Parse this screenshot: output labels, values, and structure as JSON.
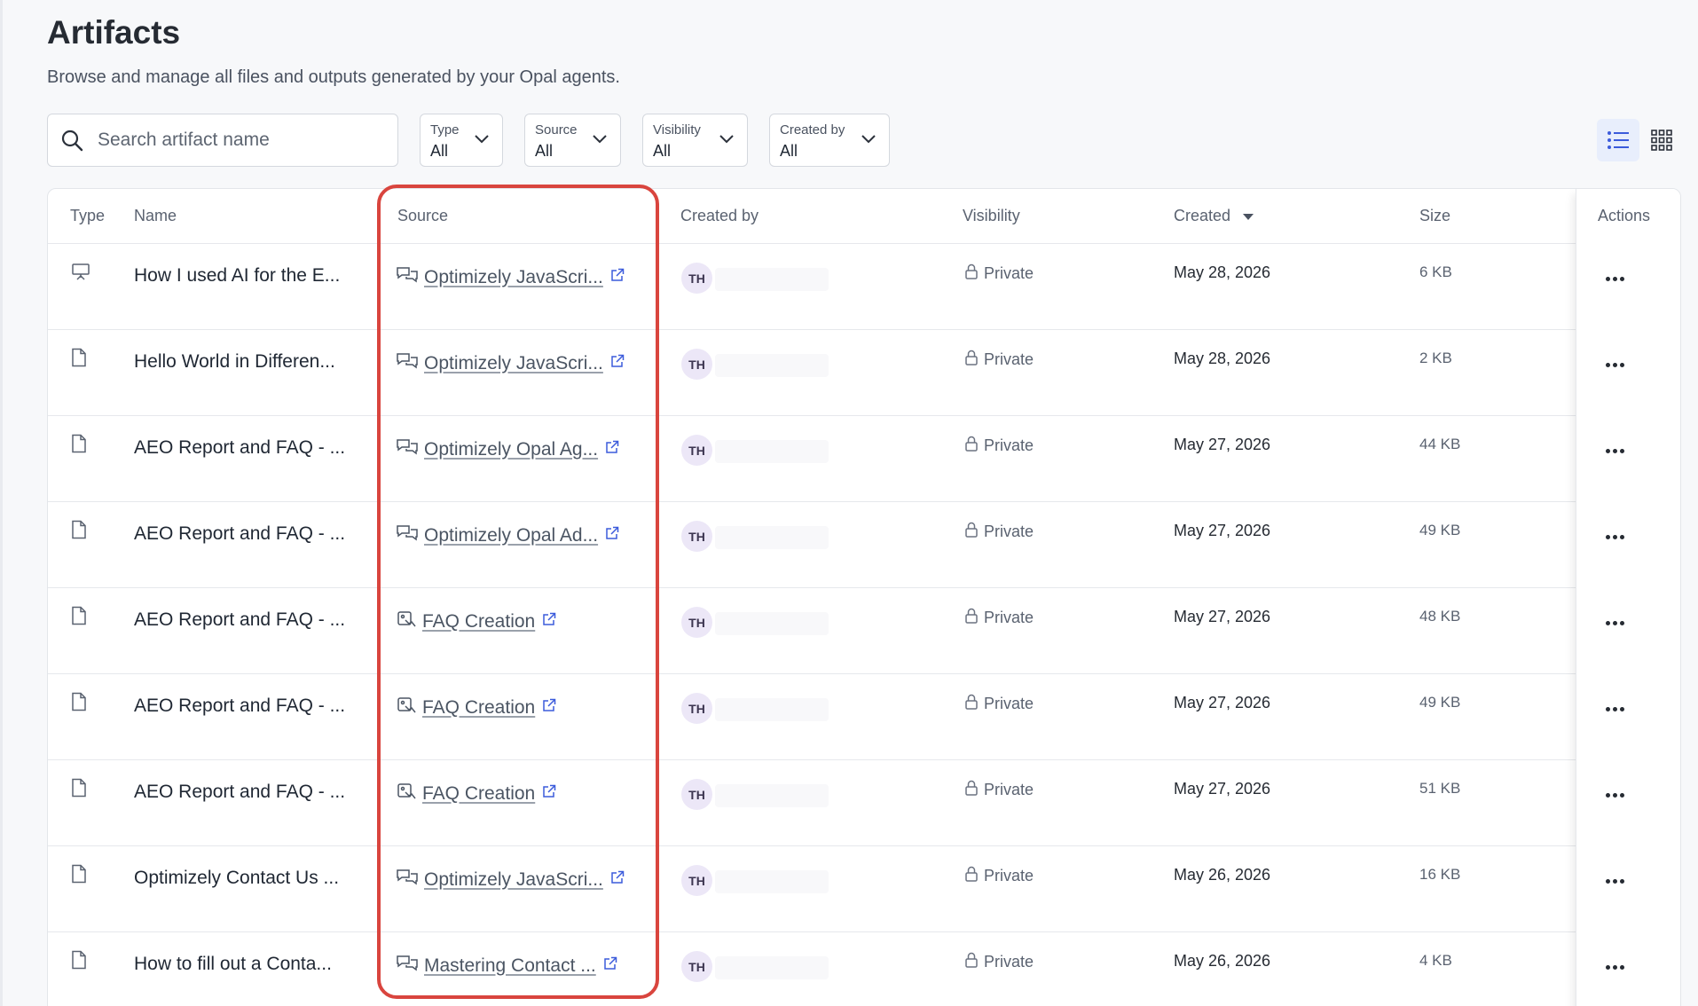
{
  "header": {
    "title": "Artifacts",
    "subtitle": "Browse and manage all files and outputs generated by your Opal agents."
  },
  "search": {
    "placeholder": "Search artifact name"
  },
  "filters": [
    {
      "label": "Type",
      "value": "All"
    },
    {
      "label": "Source",
      "value": "All"
    },
    {
      "label": "Visibility",
      "value": "All"
    },
    {
      "label": "Created by",
      "value": "All"
    }
  ],
  "table": {
    "columns": {
      "type": "Type",
      "name": "Name",
      "source": "Source",
      "created_by": "Created by",
      "visibility": "Visibility",
      "created": "Created",
      "size": "Size",
      "actions": "Actions"
    },
    "rows": [
      {
        "type_icon": "presentation-icon",
        "name": "How I used AI for the E...",
        "source_icon": "chat-icon",
        "source": "Optimizely JavaScri...",
        "initials": "TH",
        "visibility": "Private",
        "created": "May 28, 2026",
        "size": "6 KB"
      },
      {
        "type_icon": "file-icon",
        "name": "Hello World in Differen...",
        "source_icon": "chat-icon",
        "source": "Optimizely JavaScri...",
        "initials": "TH",
        "visibility": "Private",
        "created": "May 28, 2026",
        "size": "2 KB"
      },
      {
        "type_icon": "file-icon",
        "name": "AEO Report and FAQ - ...",
        "source_icon": "chat-icon",
        "source": "Optimizely Opal Ag...",
        "initials": "TH",
        "visibility": "Private",
        "created": "May 27, 2026",
        "size": "44 KB"
      },
      {
        "type_icon": "file-icon",
        "name": "AEO Report and FAQ - ...",
        "source_icon": "chat-icon",
        "source": "Optimizely Opal Ad...",
        "initials": "TH",
        "visibility": "Private",
        "created": "May 27, 2026",
        "size": "49 KB"
      },
      {
        "type_icon": "file-icon",
        "name": "AEO Report and FAQ - ...",
        "source_icon": "workflow-icon",
        "source": "FAQ Creation",
        "initials": "TH",
        "visibility": "Private",
        "created": "May 27, 2026",
        "size": "48 KB"
      },
      {
        "type_icon": "file-icon",
        "name": "AEO Report and FAQ - ...",
        "source_icon": "workflow-icon",
        "source": "FAQ Creation",
        "initials": "TH",
        "visibility": "Private",
        "created": "May 27, 2026",
        "size": "49 KB"
      },
      {
        "type_icon": "file-icon",
        "name": "AEO Report and FAQ - ...",
        "source_icon": "workflow-icon",
        "source": "FAQ Creation",
        "initials": "TH",
        "visibility": "Private",
        "created": "May 27, 2026",
        "size": "51 KB"
      },
      {
        "type_icon": "file-icon",
        "name": "Optimizely Contact Us ...",
        "source_icon": "chat-icon",
        "source": "Optimizely JavaScri...",
        "initials": "TH",
        "visibility": "Private",
        "created": "May 26, 2026",
        "size": "16 KB"
      },
      {
        "type_icon": "file-icon",
        "name": "How to fill out a Conta...",
        "source_icon": "chat-icon",
        "source": "Mastering Contact ...",
        "initials": "TH",
        "visibility": "Private",
        "created": "May 26, 2026",
        "size": "4 KB"
      }
    ]
  },
  "colors": {
    "highlight": "#d9453e",
    "avatar_bg": "#ece7f7",
    "active_view_bg": "#e8eefc",
    "accent": "#3b5bdb"
  }
}
